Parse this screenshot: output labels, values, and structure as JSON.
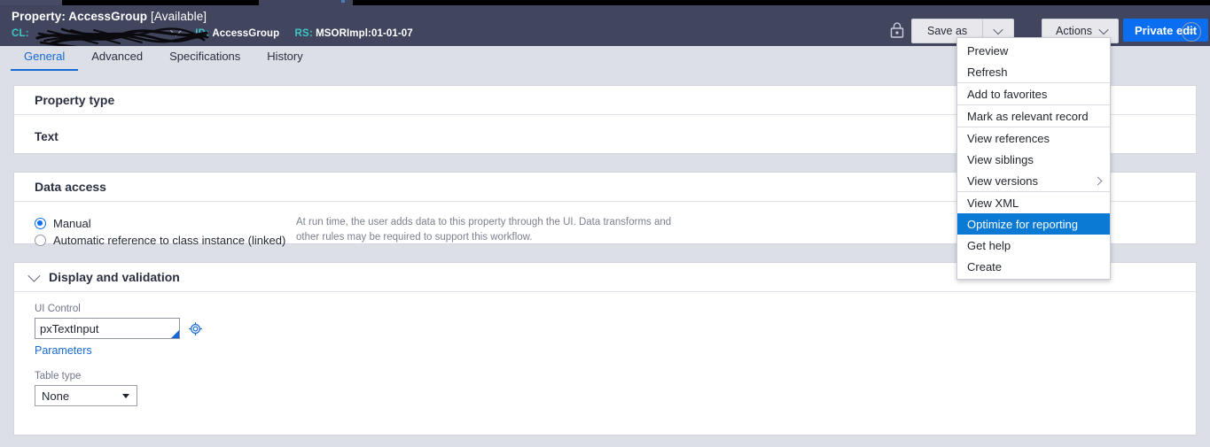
{
  "header": {
    "title_main": "Property: AccessGroup",
    "title_status": "[Available]",
    "meta": {
      "cl_label": "CL:",
      "cl_value": "",
      "id_label": "ID:",
      "id_value": "AccessGroup",
      "rs_label": "RS:",
      "rs_value": "MSORImpl:01-01-07"
    },
    "lock_icon": "lock-icon",
    "save_as_label": "Save as",
    "save_as_caret": "chevron-down-icon",
    "actions_label": "Actions",
    "actions_caret": "chevron-down-icon",
    "private_edit_label": "Private edit",
    "close_label": "×"
  },
  "tabs": [
    {
      "label": "General",
      "active": true
    },
    {
      "label": "Advanced",
      "active": false
    },
    {
      "label": "Specifications",
      "active": false
    },
    {
      "label": "History",
      "active": false
    }
  ],
  "actions_menu": {
    "items": [
      {
        "label": "Preview",
        "separator_after": false,
        "selected": false,
        "submenu": false
      },
      {
        "label": "Refresh",
        "separator_after": true,
        "selected": false,
        "submenu": false
      },
      {
        "label": "Add to favorites",
        "separator_after": true,
        "selected": false,
        "submenu": false
      },
      {
        "label": "Mark as relevant record",
        "separator_after": true,
        "selected": false,
        "submenu": false
      },
      {
        "label": "View references",
        "separator_after": false,
        "selected": false,
        "submenu": false
      },
      {
        "label": "View siblings",
        "separator_after": false,
        "selected": false,
        "submenu": false
      },
      {
        "label": "View versions",
        "separator_after": true,
        "selected": false,
        "submenu": true
      },
      {
        "label": "View XML",
        "separator_after": false,
        "selected": false,
        "submenu": false
      },
      {
        "label": "Optimize for reporting",
        "separator_after": false,
        "selected": true,
        "submenu": false
      },
      {
        "label": "Get help",
        "separator_after": false,
        "selected": false,
        "submenu": false
      },
      {
        "label": "Create",
        "separator_after": false,
        "selected": false,
        "submenu": false
      }
    ],
    "highlight_color": "#0b7ad4"
  },
  "property_type": {
    "section_title": "Property type",
    "value": "Text"
  },
  "data_access": {
    "section_title": "Data access",
    "options": [
      {
        "label": "Manual",
        "checked": true
      },
      {
        "label": "Automatic reference to class instance (linked)",
        "checked": false
      }
    ],
    "help_text": "At run time, the user adds data to this property through the UI. Data transforms and other rules may be required to support this workflow."
  },
  "display_validation": {
    "section_title": "Display and validation",
    "collapse_icon": "chevron-down-icon",
    "ui_control_label": "UI Control",
    "ui_control_value": "pxTextInput",
    "gear_icon": "gear-icon",
    "parameters_link": "Parameters",
    "table_type_label": "Table type",
    "table_type_value": "None"
  },
  "colors": {
    "header_bg": "#41455e",
    "page_bg": "#dcdfe6",
    "accent_blue": "#0b6ef0",
    "link_blue": "#1769d3",
    "teal_label": "#3fc6c6",
    "menu_highlight": "#0b7ad4"
  }
}
